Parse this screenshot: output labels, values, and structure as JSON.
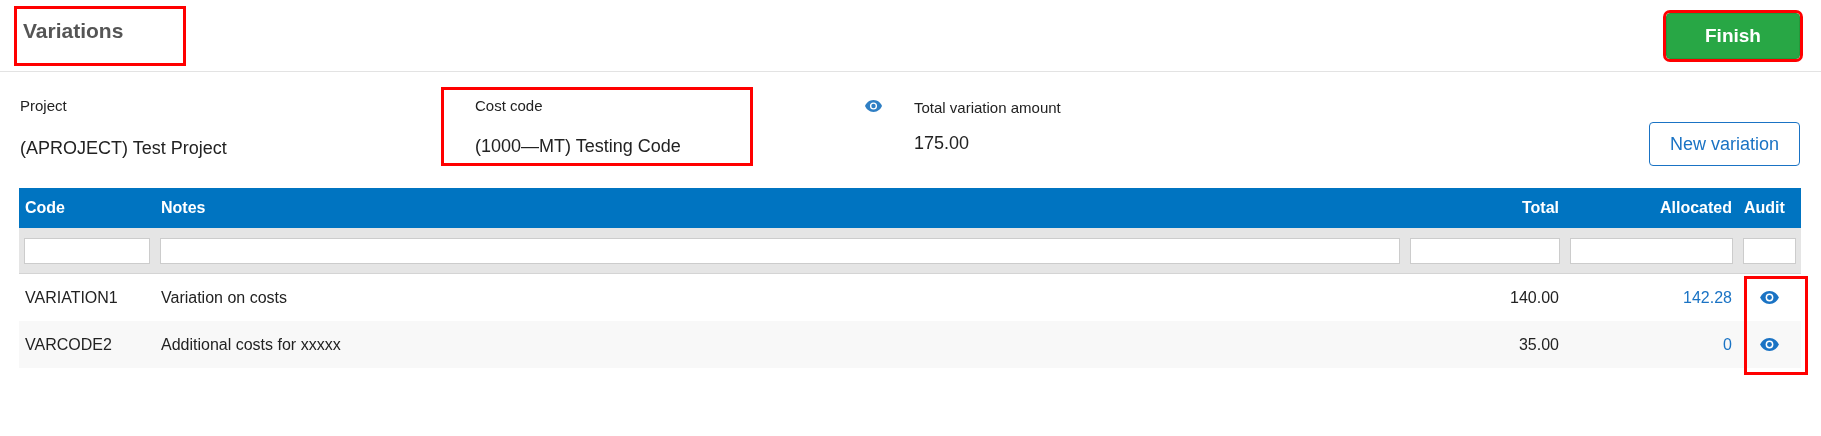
{
  "header": {
    "title": "Variations",
    "title_highlighted": true,
    "finish_button": {
      "label": "Finish",
      "highlighted": true
    }
  },
  "summary": {
    "project": {
      "label": "Project",
      "value": "(APROJECT) Test Project"
    },
    "cost_code": {
      "label": "Cost code",
      "value": "(1000—MT) Testing Code",
      "highlighted": true
    },
    "total": {
      "label": "Total variation amount",
      "value": "175.00"
    },
    "new_button": "New variation"
  },
  "table": {
    "columns": [
      {
        "label": "Code",
        "kind": "text"
      },
      {
        "label": "Notes",
        "kind": "text"
      },
      {
        "label": "Total",
        "kind": "amount"
      },
      {
        "label": "Allocated",
        "kind": "amount"
      },
      {
        "label": "Audit",
        "kind": "action"
      }
    ],
    "audit_highlighted": true,
    "rows": [
      {
        "code": "VARIATION1",
        "notes": "Variation on costs",
        "total": "140.00",
        "allocated": "142.28"
      },
      {
        "code": "VARCODE2",
        "notes": "Additional costs for xxxxx",
        "total": "35.00",
        "allocated": "0"
      }
    ]
  }
}
